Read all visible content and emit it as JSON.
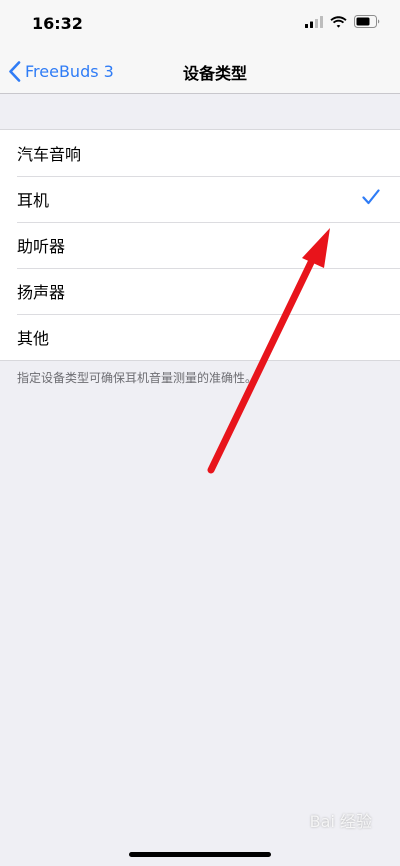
{
  "status_bar": {
    "time": "16:32"
  },
  "nav": {
    "back_label": "FreeBuds 3",
    "title": "设备类型"
  },
  "device_types": [
    {
      "label": "汽车音响",
      "selected": false
    },
    {
      "label": "耳机",
      "selected": true
    },
    {
      "label": "助听器",
      "selected": false
    },
    {
      "label": "扬声器",
      "selected": false
    },
    {
      "label": "其他",
      "selected": false
    }
  ],
  "footer_note": "指定设备类型可确保耳机音量测量的准确性。",
  "watermark": "Bai 经验",
  "colors": {
    "accent": "#2f7cf6",
    "annotation_arrow": "#e8141b",
    "background": "#efeff4"
  },
  "icons": [
    "signal-icon",
    "wifi-icon",
    "battery-icon",
    "chevron-left-icon",
    "checkmark-icon"
  ]
}
